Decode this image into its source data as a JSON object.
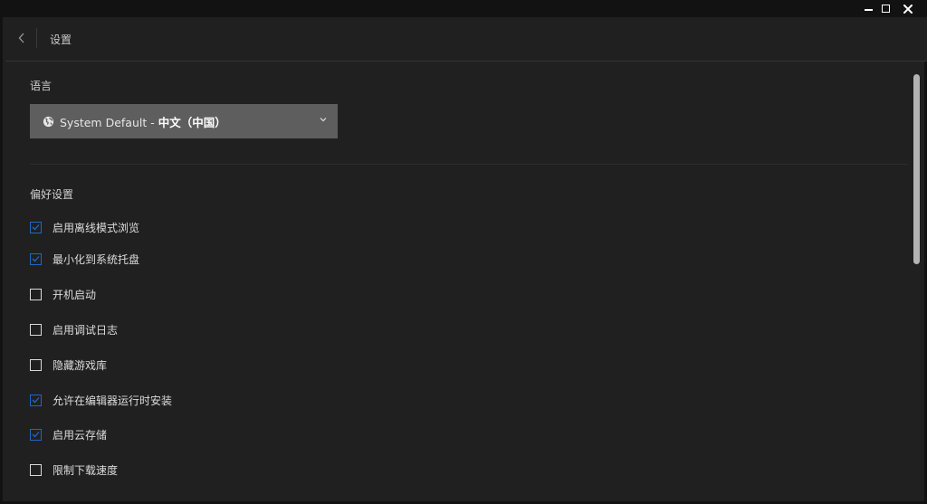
{
  "window": {
    "controls": {
      "minimize": "minimize-icon",
      "maximize": "maximize-icon",
      "close": "close-icon"
    }
  },
  "header": {
    "back_icon": "chevron-left-icon",
    "title": "设置"
  },
  "language": {
    "section_title": "语言",
    "select": {
      "icon": "globe-icon",
      "value_prefix": "System Default - ",
      "value_main": "中文（中国）",
      "chevron_icon": "chevron-down-icon"
    }
  },
  "preferences": {
    "section_title": "偏好设置",
    "items": [
      {
        "label": "启用离线模式浏览",
        "checked": true
      },
      {
        "label": "最小化到系统托盘",
        "checked": true
      },
      {
        "label": "开机启动",
        "checked": false
      },
      {
        "label": "启用调试日志",
        "checked": false
      },
      {
        "label": "隐藏游戏库",
        "checked": false
      },
      {
        "label": "允许在编辑器运行时安装",
        "checked": true
      },
      {
        "label": "启用云存储",
        "checked": true
      },
      {
        "label": "限制下载速度",
        "checked": false
      }
    ]
  },
  "colors": {
    "window_bg": "#202020",
    "titlebar_bg": "#121212",
    "select_bg": "#5e5e5e",
    "checkbox_checked": "#1f67c9",
    "scroll_thumb": "#b3b3b3"
  }
}
